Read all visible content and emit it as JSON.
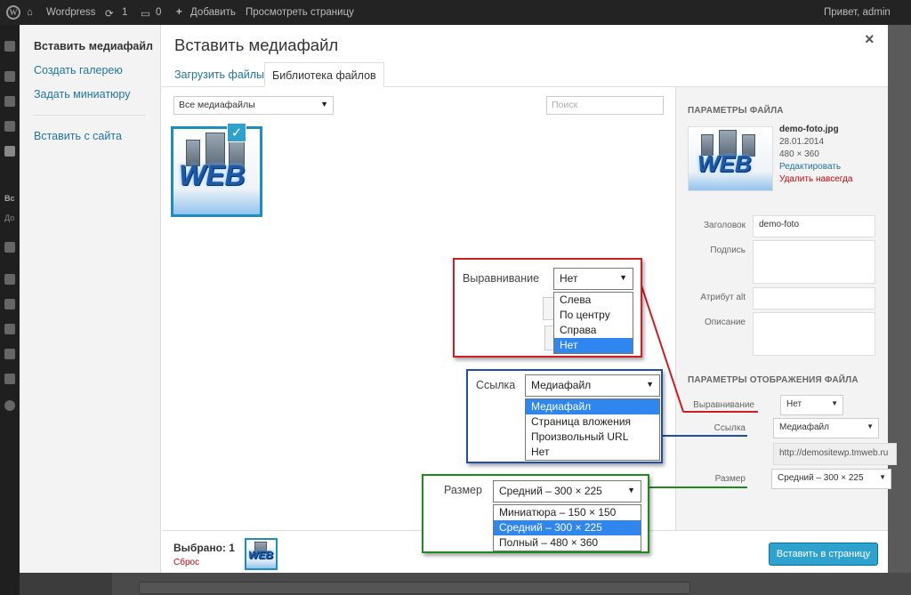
{
  "admin_bar": {
    "site_name": "Wordpress",
    "updates_count": "1",
    "comments_count": "0",
    "add_new": "Добавить",
    "view_page": "Просмотреть страницу",
    "greeting": "Привет, admin"
  },
  "background_sidebar": {
    "item1": "Вс",
    "item2": "До"
  },
  "modal": {
    "title": "Вставить медиафайл",
    "close": "×",
    "menu": [
      {
        "label": "Вставить медиафайл",
        "active": true
      },
      {
        "label": "Создать галерею",
        "active": false
      },
      {
        "label": "Задать миниатюру",
        "active": false
      },
      {
        "label": "Вставить с сайта",
        "active": false
      }
    ],
    "tabs": [
      {
        "label": "Загрузить файлы",
        "active": false
      },
      {
        "label": "Библиотека файлов",
        "active": true
      }
    ],
    "filter_value": "Все медиафайлы",
    "search_placeholder": "Поиск",
    "thumb_text": "WEB",
    "selected_check": "✓"
  },
  "attachment_details": {
    "heading": "Параметры файла",
    "filename": "demo-foto.jpg",
    "date": "28.01.2014",
    "dimensions": "480 × 360",
    "edit_link": "Редактировать",
    "delete_link": "Удалить навсегда",
    "title_label": "Заголовок",
    "title_value": "demo-foto",
    "caption_label": "Подпись",
    "alt_label": "Атрибут alt",
    "description_label": "Описание"
  },
  "display_settings": {
    "heading": "Параметры отображения файла",
    "align_label": "Выравнивание",
    "align_value": "Нет",
    "link_label": "Ссылка",
    "link_value": "Медиафайл",
    "url_value": "http://demositewp.tmweb.ru",
    "size_label": "Размер",
    "size_value": "Средний – 300 × 225"
  },
  "toolbar": {
    "selected_text": "Выбрано: 1",
    "reset": "Сброс",
    "insert_button": "Вставить в страницу"
  },
  "callouts": {
    "align": {
      "label": "Выравнивание",
      "value": "Нет",
      "options": [
        "Слева",
        "По центру",
        "Справа",
        "Нет"
      ],
      "highlighted": 3,
      "color": "#d21c24"
    },
    "link": {
      "label": "Ссылка",
      "value": "Медиафайл",
      "options": [
        "Медиафайл",
        "Страница вложения",
        "Произвольный URL",
        "Нет"
      ],
      "highlighted": 0,
      "color": "#1e4ea8"
    },
    "size": {
      "label": "Размер",
      "value": "Средний – 300 × 225",
      "options": [
        "Миниатюра – 150 × 150",
        "Средний – 300 × 225",
        "Полный – 480 × 360"
      ],
      "highlighted": 1,
      "color": "#1e8a1e"
    }
  },
  "icons": {
    "dropdown": "▼",
    "updates": "⟳",
    "comments": "💬",
    "add": "+"
  },
  "colors": {
    "accent": "#2ea2cc",
    "link": "#21759b",
    "danger": "#bc0b0b",
    "highlight": "#2f86ee"
  }
}
